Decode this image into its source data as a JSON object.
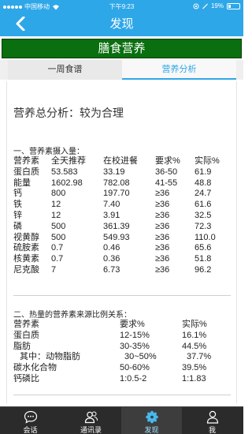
{
  "status_bar": {
    "carrier": "中国移动",
    "time": "下午9:23",
    "battery": "19%"
  },
  "nav": {
    "back_icon": "chevron-left-icon",
    "title": "发现"
  },
  "banner": {
    "title": "膳食营养"
  },
  "tabs": [
    {
      "label": "一周食谱",
      "active": false
    },
    {
      "label": "营养分析",
      "active": true
    }
  ],
  "summary": "营养总分析：较为合理",
  "section1": {
    "title": "一、营养素摄入量：",
    "header": [
      "营养素",
      "全天推荐",
      "在校进餐",
      "要求%",
      "实际%"
    ],
    "rows": [
      [
        "蛋白质",
        "53.583",
        "33.19",
        "36-50",
        "61.9"
      ],
      [
        "能量",
        "1602.98",
        "782.08",
        "41-55",
        "48.8"
      ],
      [
        "钙",
        "800",
        "197.70",
        "≥36",
        "24.7"
      ],
      [
        "铁",
        "12",
        "7.40",
        "≥36",
        "61.6"
      ],
      [
        "锌",
        "12",
        "3.91",
        "≥36",
        "32.5"
      ],
      [
        "磷",
        "500",
        "361.39",
        "≥36",
        "72.3"
      ],
      [
        "视黄醇",
        "500",
        "549.93",
        "≥36",
        "110.0"
      ],
      [
        "硫胺素",
        "0.7",
        "0.46",
        "≥36",
        "65.6"
      ],
      [
        "核黄素",
        "0.7",
        "0.36",
        "≥36",
        "51.8"
      ],
      [
        "尼克酸",
        "7",
        "6.73",
        "≥36",
        "96.2"
      ]
    ]
  },
  "section2": {
    "title": "二、热量的营养素来源比例关系：",
    "header": [
      "营养素",
      "要求%",
      "实际%"
    ],
    "rows": [
      [
        "蛋白质",
        "12-15%",
        "16.1%"
      ],
      [
        "脂肪",
        "30-35%",
        "44.5%"
      ],
      [
        "其中：动物脂肪",
        "30~50%",
        "37.7%"
      ],
      [
        "碳水化合物",
        "50-60%",
        "39.5%"
      ],
      [
        "钙磷比",
        "1:0.5-2",
        "1:1.83"
      ]
    ]
  },
  "tab_bar": [
    {
      "label": "会话",
      "icon": "chat-bubble-icon"
    },
    {
      "label": "通讯录",
      "icon": "contacts-icon"
    },
    {
      "label": "发现",
      "icon": "discover-flower-icon"
    },
    {
      "label": "我",
      "icon": "person-icon"
    }
  ]
}
